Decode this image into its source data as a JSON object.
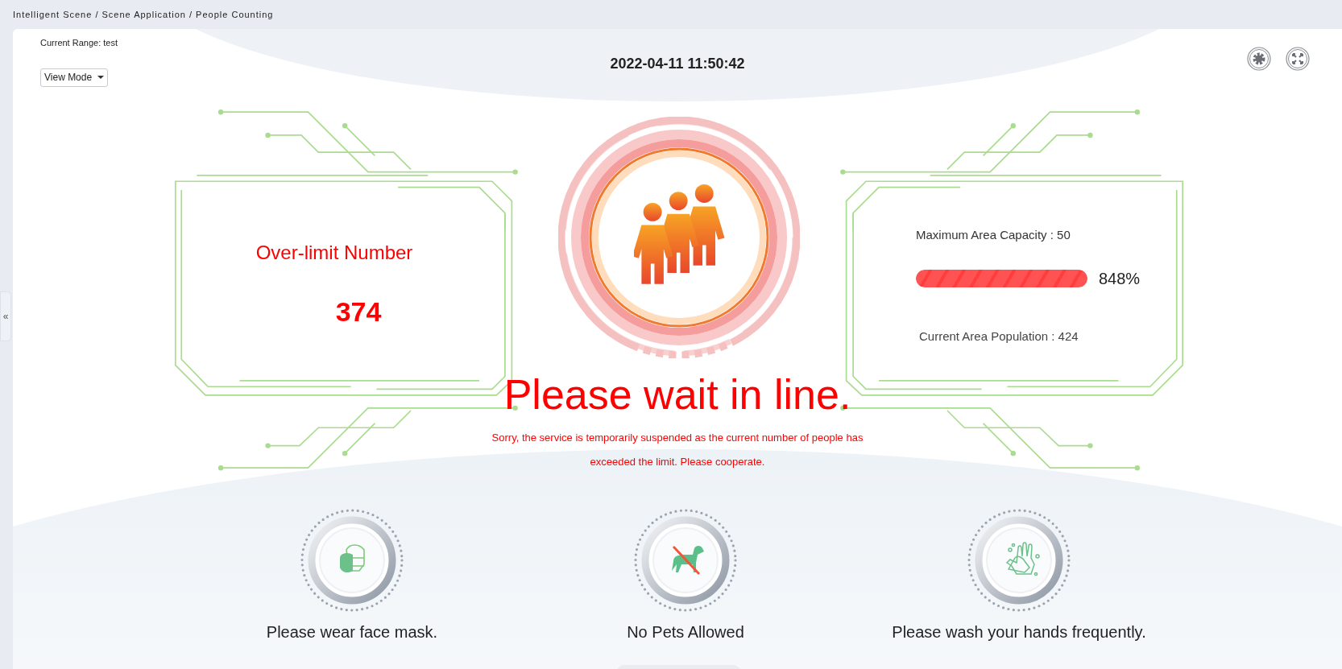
{
  "breadcrumb": "Intelligent Scene / Scene Application / People Counting",
  "sidebar_toggle": "«",
  "current_range": "Current Range: test",
  "view_mode": {
    "label": "View Mode"
  },
  "datetime": "2022-04-11 11:50:42",
  "toolbar": [
    {
      "kind": "settings"
    },
    {
      "kind": "fullscreen"
    }
  ],
  "over_limit": {
    "label": "Over-limit Number",
    "value": "374"
  },
  "capacity": {
    "maximum": "Maximum Area Capacity : 50",
    "level": 1,
    "percent": "848%",
    "population": "Current Area Population : 424"
  },
  "notice": {
    "title": "Please wait in line.",
    "detail": "Sorry, the service is temporarily suspended as the current number of people has exceeded the limit. Please cooperate."
  },
  "tips": [
    {
      "kind": "mask",
      "label": "Please wear face mask."
    },
    {
      "kind": "no-pets",
      "label": "No Pets Allowed"
    },
    {
      "kind": "wash-hands",
      "label": "Please wash your hands frequently."
    }
  ]
}
